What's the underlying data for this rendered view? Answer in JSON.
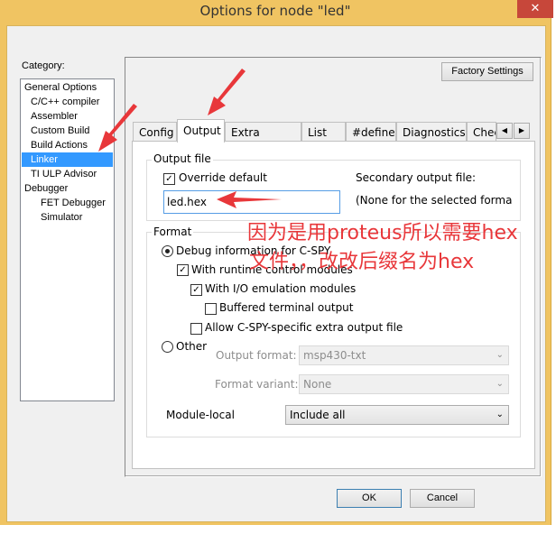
{
  "window": {
    "title": "Options for node \"led\"",
    "close_icon": "close-icon"
  },
  "category": {
    "label": "Category:",
    "items": [
      {
        "label": "General Options",
        "indent": 0
      },
      {
        "label": "C/C++ compiler",
        "indent": 1
      },
      {
        "label": "Assembler",
        "indent": 1
      },
      {
        "label": "Custom Build",
        "indent": 1
      },
      {
        "label": "Build Actions",
        "indent": 1
      },
      {
        "label": "Linker",
        "indent": 1,
        "selected": true
      },
      {
        "label": "TI ULP Advisor",
        "indent": 1
      },
      {
        "label": "Debugger",
        "indent": 0
      },
      {
        "label": "FET Debugger",
        "indent": 2
      },
      {
        "label": "Simulator",
        "indent": 2
      }
    ]
  },
  "factory_settings": "Factory Settings",
  "tabs": [
    "Config",
    "Output",
    "Extra Output",
    "List",
    "#define",
    "Diagnostics",
    "Chec"
  ],
  "active_tab": "Output",
  "output_file": {
    "group": "Output file",
    "override_label": "Override default",
    "override_checked": true,
    "filename": "led.hex",
    "secondary_label": "Secondary output file:",
    "secondary_value": "(None for the selected format"
  },
  "format": {
    "group": "Format",
    "debug_label": "Debug information for C-SPY",
    "debug_selected": true,
    "runtime_label": "With runtime control modules",
    "runtime_checked": true,
    "io_label": "With I/O emulation modules",
    "io_checked": true,
    "buffered_label": "Buffered terminal output",
    "buffered_checked": false,
    "allow_label": "Allow C-SPY-specific extra output file",
    "allow_checked": false,
    "other_label": "Other",
    "output_format_label": "Output format:",
    "output_format_value": "msp430-txt",
    "format_variant_label": "Format variant:",
    "format_variant_value": "None",
    "module_local_label": "Module-local",
    "module_local_value": "Include all"
  },
  "buttons": {
    "ok": "OK",
    "cancel": "Cancel"
  },
  "annotation": {
    "line1": "因为是用proteus所以需要hex",
    "line2": "文件，，改改后缀名为hex",
    "color": "#e8373a"
  }
}
